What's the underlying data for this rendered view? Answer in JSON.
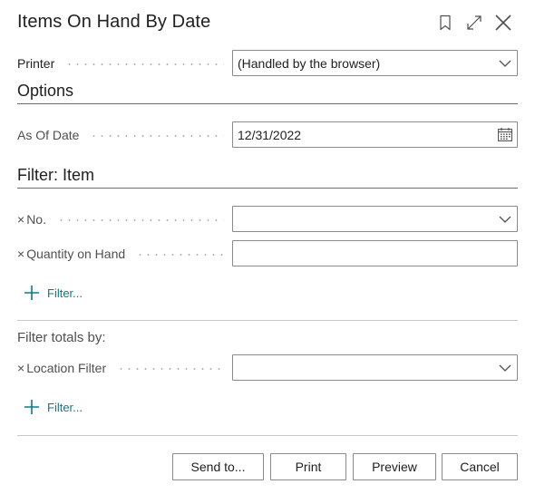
{
  "dialog": {
    "title": "Items On Hand By Date",
    "icons": [
      "bookmark-icon",
      "expand-icon",
      "close-icon"
    ]
  },
  "printer": {
    "label": "Printer",
    "value": "(Handled by the browser)"
  },
  "options": {
    "heading": "Options",
    "as_of_date_label": "As Of Date",
    "as_of_date_value": "12/31/2022"
  },
  "filter_item": {
    "heading": "Filter: Item",
    "fields": [
      {
        "remove": "×",
        "label": "No.",
        "value": ""
      },
      {
        "remove": "×",
        "label": "Quantity on Hand",
        "value": ""
      }
    ],
    "add_filter_label": "Filter..."
  },
  "filter_totals": {
    "heading": "Filter totals by:",
    "fields": [
      {
        "remove": "×",
        "label": "Location Filter",
        "value": ""
      }
    ],
    "add_filter_label": "Filter..."
  },
  "buttons": {
    "send_to": "Send to...",
    "print": "Print",
    "preview": "Preview",
    "cancel": "Cancel"
  },
  "colors": {
    "accent": "#0a7c87",
    "text": "#212121",
    "muted": "#505050",
    "border": "#8a8a8a"
  }
}
